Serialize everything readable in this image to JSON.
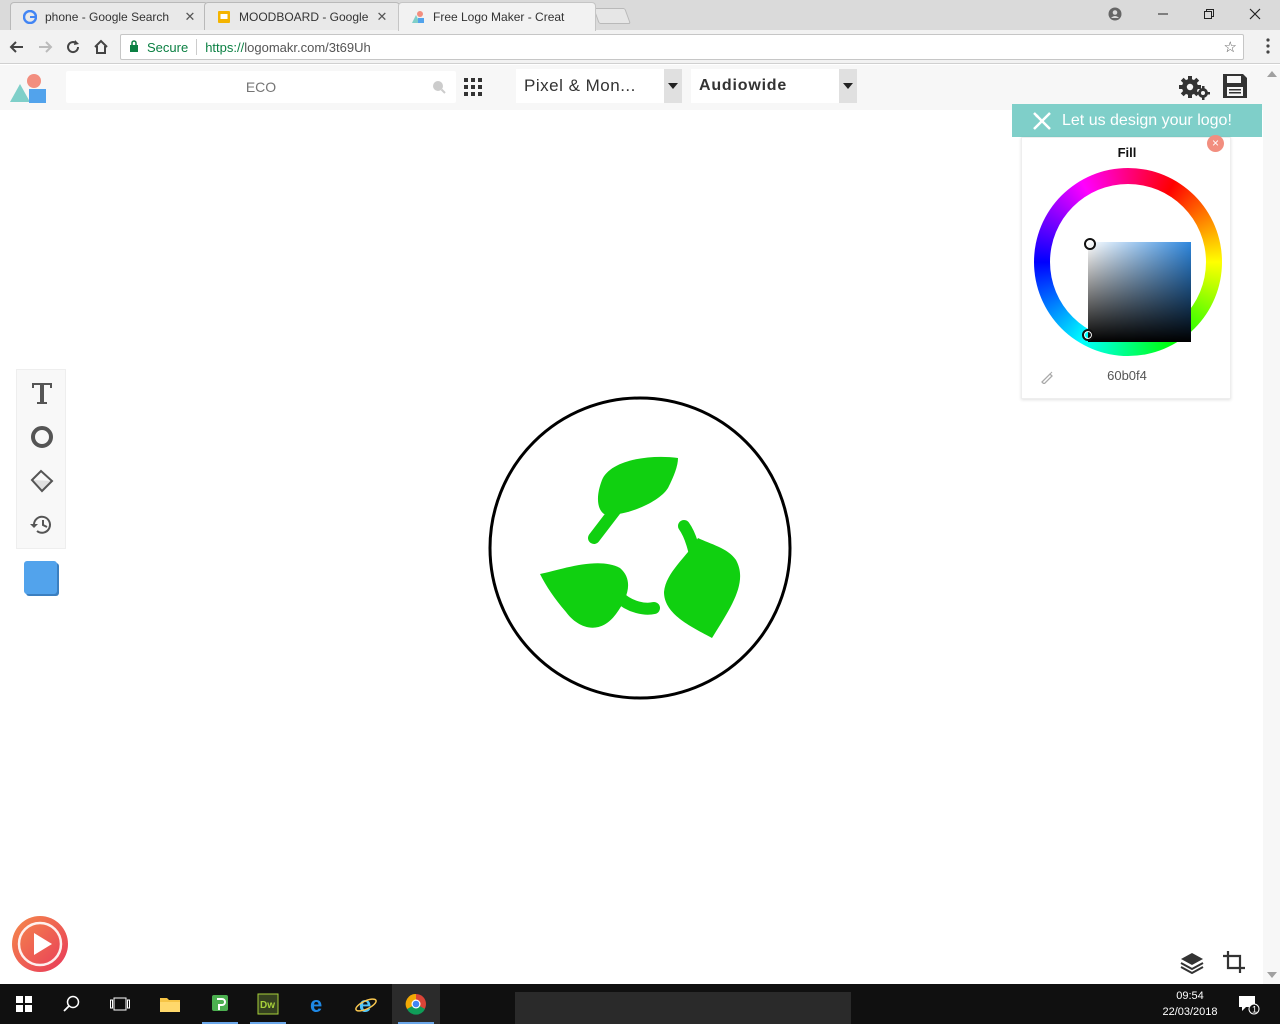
{
  "browser": {
    "tabs": [
      {
        "title": "phone - Google Search",
        "active": false
      },
      {
        "title": "MOODBOARD - Google",
        "active": false
      },
      {
        "title": "Free Logo Maker - Creat",
        "active": true
      }
    ],
    "address": {
      "secure_label": "Secure",
      "url_scheme": "https://",
      "url_rest": "logomakr.com/3t69Uh"
    }
  },
  "app": {
    "search": {
      "placeholder": "ECO"
    },
    "font_selects": [
      {
        "value": "Pixel & Mon..."
      },
      {
        "value": "Audiowide"
      }
    ],
    "promo_label": "Let us design your logo!",
    "color_picker": {
      "title": "Fill",
      "hex_value": "60b0f4",
      "close_glyph": "×"
    },
    "canvas": {
      "ring_color": "#000000",
      "leaf_color": "#10d010"
    },
    "swatch_color": "#52a3ec"
  },
  "taskbar": {
    "time": "09:54",
    "date": "22/03/2018",
    "notification_count": "1"
  }
}
